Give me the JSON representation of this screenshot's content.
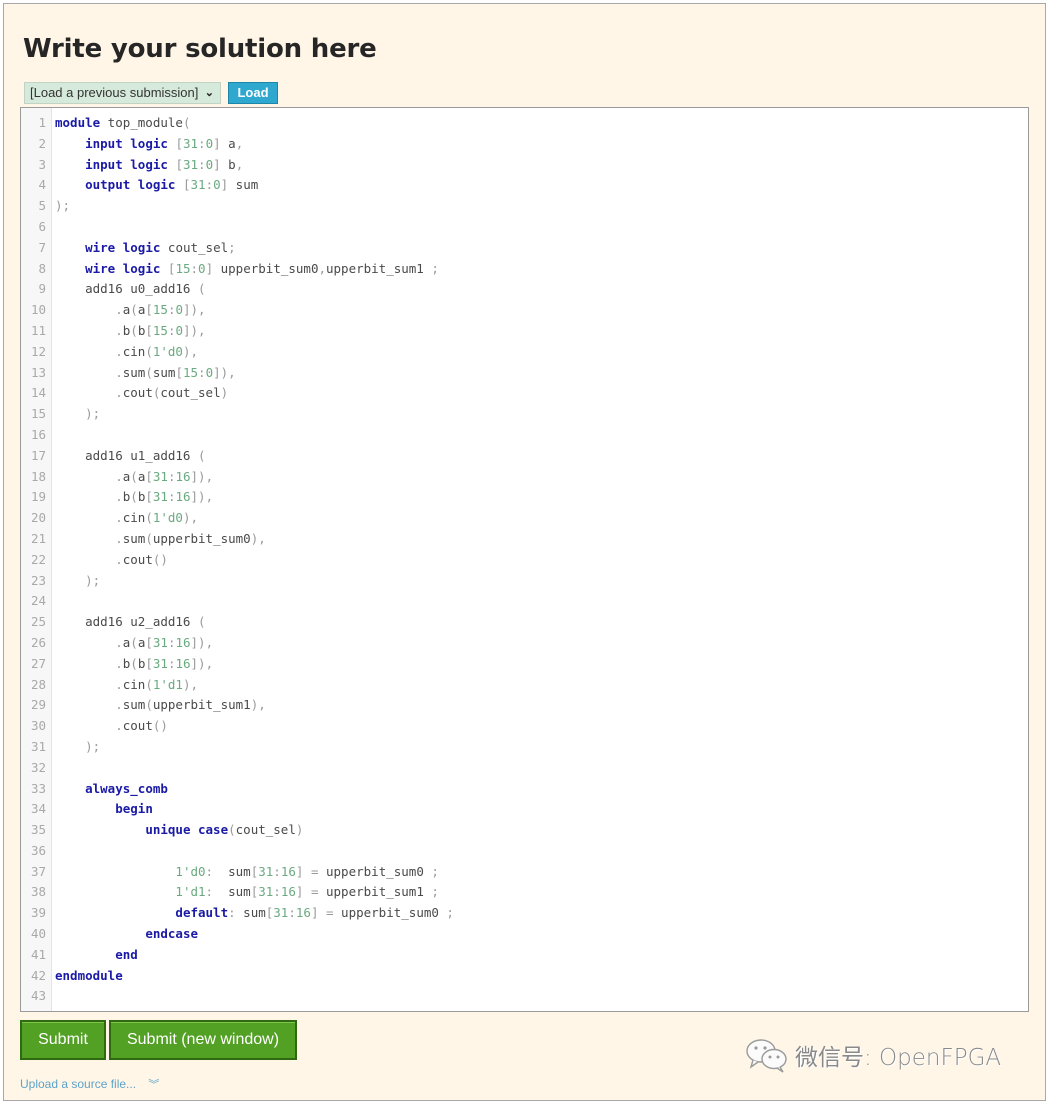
{
  "page": {
    "title": "Write your solution here"
  },
  "toolbar": {
    "select_value": "[Load a previous submission]",
    "load_label": "Load"
  },
  "editor": {
    "language": "SystemVerilog",
    "colors": {
      "keyword": "#1a1aa6",
      "number": "#6aaa80",
      "punctuation": "#9a9a9a",
      "identifier": "#4a4a4a"
    },
    "lines": [
      [
        [
          "kw",
          "module"
        ],
        [
          "id",
          " top_module"
        ],
        [
          "p",
          "("
        ]
      ],
      [
        [
          "id",
          "    "
        ],
        [
          "kw",
          "input"
        ],
        [
          "id",
          " "
        ],
        [
          "kw",
          "logic"
        ],
        [
          "id",
          " "
        ],
        [
          "p",
          "["
        ],
        [
          "n",
          "31"
        ],
        [
          "p",
          ":"
        ],
        [
          "n",
          "0"
        ],
        [
          "p",
          "]"
        ],
        [
          "id",
          " a"
        ],
        [
          "p",
          ","
        ]
      ],
      [
        [
          "id",
          "    "
        ],
        [
          "kw",
          "input"
        ],
        [
          "id",
          " "
        ],
        [
          "kw",
          "logic"
        ],
        [
          "id",
          " "
        ],
        [
          "p",
          "["
        ],
        [
          "n",
          "31"
        ],
        [
          "p",
          ":"
        ],
        [
          "n",
          "0"
        ],
        [
          "p",
          "]"
        ],
        [
          "id",
          " b"
        ],
        [
          "p",
          ","
        ]
      ],
      [
        [
          "id",
          "    "
        ],
        [
          "kw",
          "output"
        ],
        [
          "id",
          " "
        ],
        [
          "kw",
          "logic"
        ],
        [
          "id",
          " "
        ],
        [
          "p",
          "["
        ],
        [
          "n",
          "31"
        ],
        [
          "p",
          ":"
        ],
        [
          "n",
          "0"
        ],
        [
          "p",
          "]"
        ],
        [
          "id",
          " sum"
        ]
      ],
      [
        [
          "p",
          ");"
        ]
      ],
      [],
      [
        [
          "id",
          "    "
        ],
        [
          "kw",
          "wire"
        ],
        [
          "id",
          " "
        ],
        [
          "kw",
          "logic"
        ],
        [
          "id",
          " cout_sel"
        ],
        [
          "p",
          ";"
        ]
      ],
      [
        [
          "id",
          "    "
        ],
        [
          "kw",
          "wire"
        ],
        [
          "id",
          " "
        ],
        [
          "kw",
          "logic"
        ],
        [
          "id",
          " "
        ],
        [
          "p",
          "["
        ],
        [
          "n",
          "15"
        ],
        [
          "p",
          ":"
        ],
        [
          "n",
          "0"
        ],
        [
          "p",
          "]"
        ],
        [
          "id",
          " upperbit_sum0"
        ],
        [
          "p",
          ","
        ],
        [
          "id",
          "upperbit_sum1 "
        ],
        [
          "p",
          ";"
        ]
      ],
      [
        [
          "id",
          "    add16 u0_add16 "
        ],
        [
          "p",
          "("
        ]
      ],
      [
        [
          "id",
          "        "
        ],
        [
          "p",
          "."
        ],
        [
          "id",
          "a"
        ],
        [
          "p",
          "("
        ],
        [
          "id",
          "a"
        ],
        [
          "p",
          "["
        ],
        [
          "n",
          "15"
        ],
        [
          "p",
          ":"
        ],
        [
          "n",
          "0"
        ],
        [
          "p",
          "]),"
        ]
      ],
      [
        [
          "id",
          "        "
        ],
        [
          "p",
          "."
        ],
        [
          "id",
          "b"
        ],
        [
          "p",
          "("
        ],
        [
          "id",
          "b"
        ],
        [
          "p",
          "["
        ],
        [
          "n",
          "15"
        ],
        [
          "p",
          ":"
        ],
        [
          "n",
          "0"
        ],
        [
          "p",
          "]),"
        ]
      ],
      [
        [
          "id",
          "        "
        ],
        [
          "p",
          "."
        ],
        [
          "id",
          "cin"
        ],
        [
          "p",
          "("
        ],
        [
          "n",
          "1'd0"
        ],
        [
          "p",
          "),"
        ]
      ],
      [
        [
          "id",
          "        "
        ],
        [
          "p",
          "."
        ],
        [
          "id",
          "sum"
        ],
        [
          "p",
          "("
        ],
        [
          "id",
          "sum"
        ],
        [
          "p",
          "["
        ],
        [
          "n",
          "15"
        ],
        [
          "p",
          ":"
        ],
        [
          "n",
          "0"
        ],
        [
          "p",
          "]),"
        ]
      ],
      [
        [
          "id",
          "        "
        ],
        [
          "p",
          "."
        ],
        [
          "id",
          "cout"
        ],
        [
          "p",
          "("
        ],
        [
          "id",
          "cout_sel"
        ],
        [
          "p",
          ")"
        ]
      ],
      [
        [
          "id",
          "    "
        ],
        [
          "p",
          ");"
        ]
      ],
      [],
      [
        [
          "id",
          "    add16 u1_add16 "
        ],
        [
          "p",
          "("
        ]
      ],
      [
        [
          "id",
          "        "
        ],
        [
          "p",
          "."
        ],
        [
          "id",
          "a"
        ],
        [
          "p",
          "("
        ],
        [
          "id",
          "a"
        ],
        [
          "p",
          "["
        ],
        [
          "n",
          "31"
        ],
        [
          "p",
          ":"
        ],
        [
          "n",
          "16"
        ],
        [
          "p",
          "]),"
        ]
      ],
      [
        [
          "id",
          "        "
        ],
        [
          "p",
          "."
        ],
        [
          "id",
          "b"
        ],
        [
          "p",
          "("
        ],
        [
          "id",
          "b"
        ],
        [
          "p",
          "["
        ],
        [
          "n",
          "31"
        ],
        [
          "p",
          ":"
        ],
        [
          "n",
          "16"
        ],
        [
          "p",
          "]),"
        ]
      ],
      [
        [
          "id",
          "        "
        ],
        [
          "p",
          "."
        ],
        [
          "id",
          "cin"
        ],
        [
          "p",
          "("
        ],
        [
          "n",
          "1'd0"
        ],
        [
          "p",
          "),"
        ]
      ],
      [
        [
          "id",
          "        "
        ],
        [
          "p",
          "."
        ],
        [
          "id",
          "sum"
        ],
        [
          "p",
          "("
        ],
        [
          "id",
          "upperbit_sum0"
        ],
        [
          "p",
          "),"
        ]
      ],
      [
        [
          "id",
          "        "
        ],
        [
          "p",
          "."
        ],
        [
          "id",
          "cout"
        ],
        [
          "p",
          "()"
        ]
      ],
      [
        [
          "id",
          "    "
        ],
        [
          "p",
          ");"
        ]
      ],
      [],
      [
        [
          "id",
          "    add16 u2_add16 "
        ],
        [
          "p",
          "("
        ]
      ],
      [
        [
          "id",
          "        "
        ],
        [
          "p",
          "."
        ],
        [
          "id",
          "a"
        ],
        [
          "p",
          "("
        ],
        [
          "id",
          "a"
        ],
        [
          "p",
          "["
        ],
        [
          "n",
          "31"
        ],
        [
          "p",
          ":"
        ],
        [
          "n",
          "16"
        ],
        [
          "p",
          "]),"
        ]
      ],
      [
        [
          "id",
          "        "
        ],
        [
          "p",
          "."
        ],
        [
          "id",
          "b"
        ],
        [
          "p",
          "("
        ],
        [
          "id",
          "b"
        ],
        [
          "p",
          "["
        ],
        [
          "n",
          "31"
        ],
        [
          "p",
          ":"
        ],
        [
          "n",
          "16"
        ],
        [
          "p",
          "]),"
        ]
      ],
      [
        [
          "id",
          "        "
        ],
        [
          "p",
          "."
        ],
        [
          "id",
          "cin"
        ],
        [
          "p",
          "("
        ],
        [
          "n",
          "1'd1"
        ],
        [
          "p",
          "),"
        ]
      ],
      [
        [
          "id",
          "        "
        ],
        [
          "p",
          "."
        ],
        [
          "id",
          "sum"
        ],
        [
          "p",
          "("
        ],
        [
          "id",
          "upperbit_sum1"
        ],
        [
          "p",
          "),"
        ]
      ],
      [
        [
          "id",
          "        "
        ],
        [
          "p",
          "."
        ],
        [
          "id",
          "cout"
        ],
        [
          "p",
          "()"
        ]
      ],
      [
        [
          "id",
          "    "
        ],
        [
          "p",
          ");"
        ]
      ],
      [],
      [
        [
          "id",
          "    "
        ],
        [
          "kw",
          "always_comb"
        ]
      ],
      [
        [
          "id",
          "        "
        ],
        [
          "kw",
          "begin"
        ]
      ],
      [
        [
          "id",
          "            "
        ],
        [
          "kw",
          "unique"
        ],
        [
          "id",
          " "
        ],
        [
          "kw",
          "case"
        ],
        [
          "p",
          "("
        ],
        [
          "id",
          "cout_sel"
        ],
        [
          "p",
          ")"
        ]
      ],
      [],
      [
        [
          "id",
          "                "
        ],
        [
          "n",
          "1'd0"
        ],
        [
          "p",
          ":"
        ],
        [
          "id",
          "  sum"
        ],
        [
          "p",
          "["
        ],
        [
          "n",
          "31"
        ],
        [
          "p",
          ":"
        ],
        [
          "n",
          "16"
        ],
        [
          "p",
          "]"
        ],
        [
          "id",
          " "
        ],
        [
          "p",
          "="
        ],
        [
          "id",
          " upperbit_sum0 "
        ],
        [
          "p",
          ";"
        ]
      ],
      [
        [
          "id",
          "                "
        ],
        [
          "n",
          "1'd1"
        ],
        [
          "p",
          ":"
        ],
        [
          "id",
          "  sum"
        ],
        [
          "p",
          "["
        ],
        [
          "n",
          "31"
        ],
        [
          "p",
          ":"
        ],
        [
          "n",
          "16"
        ],
        [
          "p",
          "]"
        ],
        [
          "id",
          " "
        ],
        [
          "p",
          "="
        ],
        [
          "id",
          " upperbit_sum1 "
        ],
        [
          "p",
          ";"
        ]
      ],
      [
        [
          "id",
          "                "
        ],
        [
          "kw",
          "default"
        ],
        [
          "p",
          ":"
        ],
        [
          "id",
          " sum"
        ],
        [
          "p",
          "["
        ],
        [
          "n",
          "31"
        ],
        [
          "p",
          ":"
        ],
        [
          "n",
          "16"
        ],
        [
          "p",
          "]"
        ],
        [
          "id",
          " "
        ],
        [
          "p",
          "="
        ],
        [
          "id",
          " upperbit_sum0 "
        ],
        [
          "p",
          ";"
        ]
      ],
      [
        [
          "id",
          "            "
        ],
        [
          "kw",
          "endcase"
        ]
      ],
      [
        [
          "id",
          "        "
        ],
        [
          "kw",
          "end"
        ]
      ],
      [
        [
          "kw",
          "endmodule"
        ]
      ],
      []
    ]
  },
  "actions": {
    "submit_label": "Submit",
    "submit_new_window_label": "Submit (new window)",
    "upload_label": "Upload a source file...",
    "upload_icon": "double-chevron-down-icon"
  },
  "watermark": {
    "icon": "wechat-icon",
    "text": "微信号: OpenFPGA"
  }
}
